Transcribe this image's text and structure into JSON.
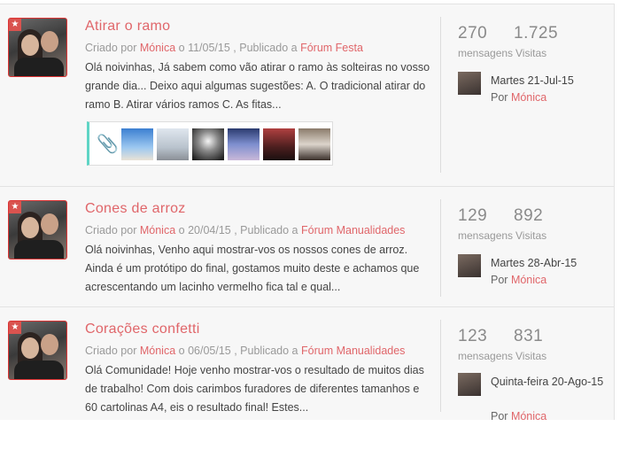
{
  "posts": [
    {
      "title": "Atirar o ramo",
      "created_by_label": "Criado por",
      "author": "Mónica",
      "date_prefix": "o",
      "date": "11/05/15",
      "published_label": ", Publicado a",
      "forum": "Fórum Festa",
      "excerpt": "Olá noivinhas, Já sabem como vão atirar o ramo às solteiras no vosso grande dia... Deixo aqui algumas sugestões: A. O tradicional atirar do ramo B. Atirar vários ramos C. As fitas...",
      "messages_count": "270",
      "messages_label": "mensagens",
      "visits_count": "1.725",
      "visits_label": "Visitas",
      "last_date": "Martes 21-Jul-15",
      "last_by_label": "Por",
      "last_author": "Mónica"
    },
    {
      "title": "Cones de arroz",
      "created_by_label": "Criado por",
      "author": "Mónica",
      "date_prefix": "o",
      "date": "20/04/15",
      "published_label": ", Publicado a",
      "forum": "Fórum Manualidades",
      "excerpt": "Olá noivinhas, Venho aqui mostrar-vos os nossos cones de arroz. Ainda é um protótipo do final, gostamos muito deste e achamos que acrescentando um lacinho vermelho fica tal e qual...",
      "messages_count": "129",
      "messages_label": "mensagens",
      "visits_count": "892",
      "visits_label": "Visitas",
      "last_date": "Martes 28-Abr-15",
      "last_by_label": "Por",
      "last_author": "Mónica"
    },
    {
      "title": "Corações confetti",
      "created_by_label": "Criado por",
      "author": "Mónica",
      "date_prefix": "o",
      "date": "06/05/15",
      "published_label": ", Publicado a",
      "forum": "Fórum Manualidades",
      "excerpt": "Olá Comunidade! Hoje venho mostrar-vos o resultado de muitos dias de trabalho! Com dois carimbos furadores de diferentes tamanhos e 60 cartolinas A4, eis o resultado final! Estes...",
      "messages_count": "123",
      "messages_label": "mensagens",
      "visits_count": "831",
      "visits_label": "Visitas",
      "last_date": "Quinta-feira 20-Ago-15",
      "last_by_label": "Por",
      "last_author": "Mónica"
    }
  ],
  "colors": {
    "accent": "#e0666a",
    "attachment_bar": "#5fd5c5",
    "muted": "#999999"
  },
  "icons": {
    "featured": "star-icon",
    "attachment": "paperclip-icon"
  }
}
